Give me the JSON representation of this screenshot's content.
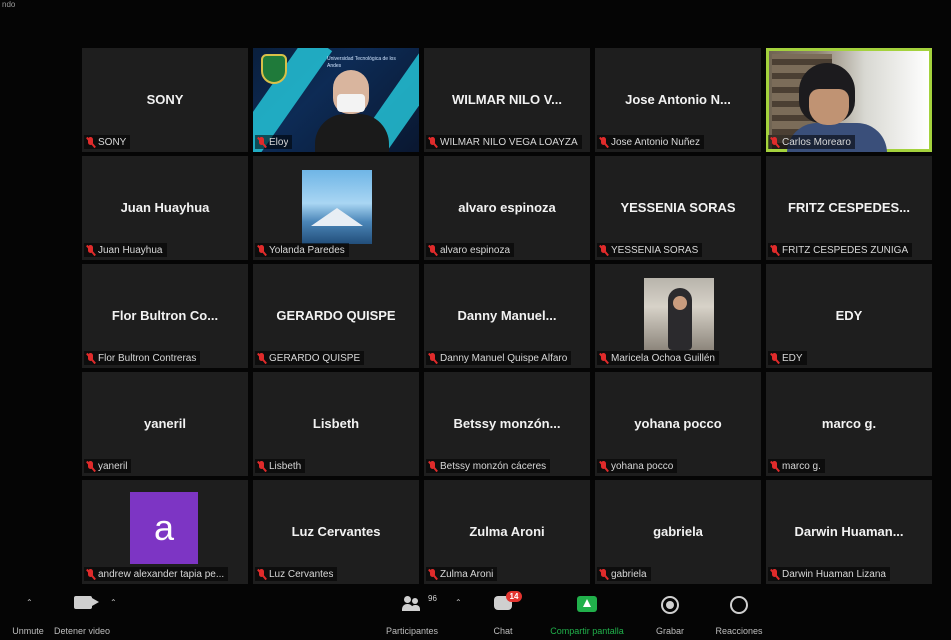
{
  "window": {
    "top_label": "ndo"
  },
  "tiles": [
    {
      "center": "SONY",
      "footer": "SONY",
      "kind": "name"
    },
    {
      "center": "",
      "footer": "Eloy",
      "kind": "banner",
      "banner_text": "Universidad Tecnológica de los Andes"
    },
    {
      "center": "WILMAR NILO V...",
      "footer": "WILMAR NILO VEGA LOAYZA",
      "kind": "name"
    },
    {
      "center": "Jose Antonio N...",
      "footer": "Jose Antonio Nuñez",
      "kind": "name"
    },
    {
      "center": "",
      "footer": "Carlos Morearo",
      "kind": "camera",
      "active": true
    },
    {
      "center": "Juan Huayhua",
      "footer": "Juan Huayhua",
      "kind": "name"
    },
    {
      "center": "",
      "footer": "Yolanda Paredes",
      "kind": "photo-mountain"
    },
    {
      "center": "alvaro espinoza",
      "footer": "alvaro espinoza",
      "kind": "name"
    },
    {
      "center": "YESSENIA SORAS",
      "footer": "YESSENIA SORAS",
      "kind": "name"
    },
    {
      "center": "FRITZ  CESPEDES...",
      "footer": "FRITZ CESPEDES ZUÑIGA",
      "kind": "name"
    },
    {
      "center": "Flor  Bultron Co...",
      "footer": "Flor Bultron Contreras",
      "kind": "name"
    },
    {
      "center": "GERARDO QUISPE",
      "footer": "GERARDO QUISPE",
      "kind": "name"
    },
    {
      "center": "Danny  Manuel...",
      "footer": "Danny Manuel Quispe Alfaro",
      "kind": "name"
    },
    {
      "center": "",
      "footer": "Maricela Ochoa Guillén",
      "kind": "photo-person"
    },
    {
      "center": "EDY",
      "footer": "EDY",
      "kind": "name"
    },
    {
      "center": "yaneril",
      "footer": "yaneril",
      "kind": "name"
    },
    {
      "center": "Lisbeth",
      "footer": "Lisbeth",
      "kind": "name"
    },
    {
      "center": "Betssy  monzón...",
      "footer": "Betssy monzón cáceres",
      "kind": "name"
    },
    {
      "center": "yohana pocco",
      "footer": "yohana pocco",
      "kind": "name"
    },
    {
      "center": "marco g.",
      "footer": "marco g.",
      "kind": "name"
    },
    {
      "center": "",
      "footer": "andrew alexander tapia pe...",
      "kind": "avatar",
      "avatar_letter": "a"
    },
    {
      "center": "Luz Cervantes",
      "footer": "Luz Cervantes",
      "kind": "name"
    },
    {
      "center": "Zulma Aroni",
      "footer": "Zulma Aroni",
      "kind": "name"
    },
    {
      "center": "gabriela",
      "footer": "gabriela",
      "kind": "name"
    },
    {
      "center": "Darwin  Huaman...",
      "footer": "Darwin Huaman Lizana",
      "kind": "name"
    }
  ],
  "toolbar": {
    "mute_label": "Unmute",
    "video_label": "Detener video",
    "participants_label": "Participantes",
    "participants_count": "96",
    "chat_label": "Chat",
    "chat_badge": "14",
    "share_label": "Compartir pantalla",
    "record_label": "Grabar",
    "reactions_label": "Reacciones"
  },
  "colors": {
    "active_border": "#a4d23d",
    "muted_mic": "#e02b2b",
    "share_green": "#21b04b",
    "avatar_purple": "#7d35c4"
  }
}
